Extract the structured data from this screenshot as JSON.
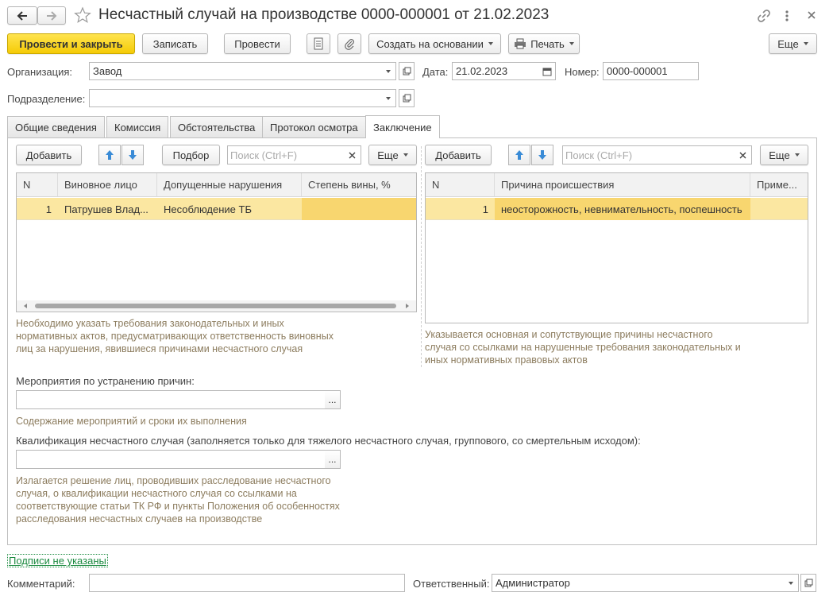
{
  "window": {
    "title": "Несчастный случай на производстве 0000-000001 от 21.02.2023"
  },
  "toolbar": {
    "post_close": "Провести и закрыть",
    "write": "Записать",
    "post": "Провести",
    "create_based": "Создать на основании",
    "print": "Печать",
    "more": "Еще"
  },
  "header": {
    "org_label": "Организация:",
    "org_value": "Завод",
    "date_label": "Дата:",
    "date_value": "21.02.2023",
    "number_label": "Номер:",
    "number_value": "0000-000001",
    "dept_label": "Подразделение:",
    "dept_value": ""
  },
  "tabs": [
    "Общие сведения",
    "Комиссия",
    "Обстоятельства",
    "Протокол осмотра",
    "Заключение"
  ],
  "left_table": {
    "add": "Добавить",
    "pick": "Подбор",
    "search_placeholder": "Поиск (Ctrl+F)",
    "more": "Еще",
    "columns": [
      "N",
      "Виновное лицо",
      "Допущенные нарушения",
      "Степень вины, %"
    ],
    "rows": [
      {
        "n": "1",
        "person": "Патрушев Влад...",
        "violations": "Несоблюдение ТБ",
        "degree": ""
      }
    ],
    "hint": "Необходимо указать требования законодательных и иных нормативных актов, предусматривающих ответственность виновных лиц за нарушения, явившиеся причинами несчастного случая"
  },
  "right_table": {
    "add": "Добавить",
    "search_placeholder": "Поиск (Ctrl+F)",
    "more": "Еще",
    "columns": [
      "N",
      "Причина происшествия",
      "Приме..."
    ],
    "rows": [
      {
        "n": "1",
        "cause": "неосторожность, невнимательность, поспешность",
        "note": ""
      }
    ],
    "hint": "Указывается основная и сопутствующие причины несчастного случая со ссылками на нарушенные требования законодательных и иных нормативных правовых актов"
  },
  "measures": {
    "label": "Мероприятия по устранению причин:",
    "value": "",
    "hint": "Содержание мероприятий и сроки их выполнения"
  },
  "qualification": {
    "label": "Квалификация несчастного случая (заполняется только для тяжелого несчастного случая, группового, со смертельным исходом):",
    "value": "",
    "hint": "Излагается решение лиц, проводивших расследование несчастного случая, о квалификации несчастного случая со ссылками на соответствующие статьи ТК РФ и пункты Положения об особенностях расследования несчастных случаев на производстве"
  },
  "footer": {
    "signatures_link": "Подписи не указаны",
    "comment_label": "Комментарий:",
    "comment_value": "",
    "responsible_label": "Ответственный:",
    "responsible_value": "Администратор"
  },
  "colors": {
    "primary_button": "#f5cb06",
    "selected_row": "#fbe7a1",
    "selected_cell": "#f8d66f",
    "hint_text": "#8c7c5e",
    "link": "#1a8a3f"
  }
}
